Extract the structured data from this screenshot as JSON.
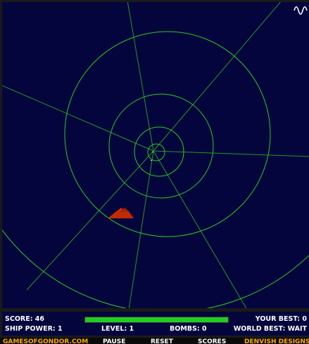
{
  "game": {
    "colors": {
      "background": "#05053d",
      "ring_color": "#22cc22",
      "spoke_color": "#229922",
      "ship_color": "#dd3300",
      "hud_text": "#ffffff",
      "power_bar": "#22cc22",
      "menu_gold": "#ffaa00",
      "menu_white": "#ffffff"
    },
    "icons": {
      "sound": "sound-wave-icon",
      "ship": "ship-icon"
    }
  },
  "hud": {
    "score": "SCORE: 46",
    "your_best": "YOUR BEST: 0",
    "ship_power": "SHIP POWER: 1",
    "level": "LEVEL: 1",
    "bombs": "BOMBS: 0",
    "world_best": "WORLD BEST: WAIT",
    "power_level_fraction": 1.0
  },
  "menu": {
    "site_link": "GAMESOFGONDOR.COM",
    "pause": "PAUSE",
    "reset": "RESET",
    "scores": "SCORES",
    "designs_link": "DENVISH DESIGNS"
  }
}
